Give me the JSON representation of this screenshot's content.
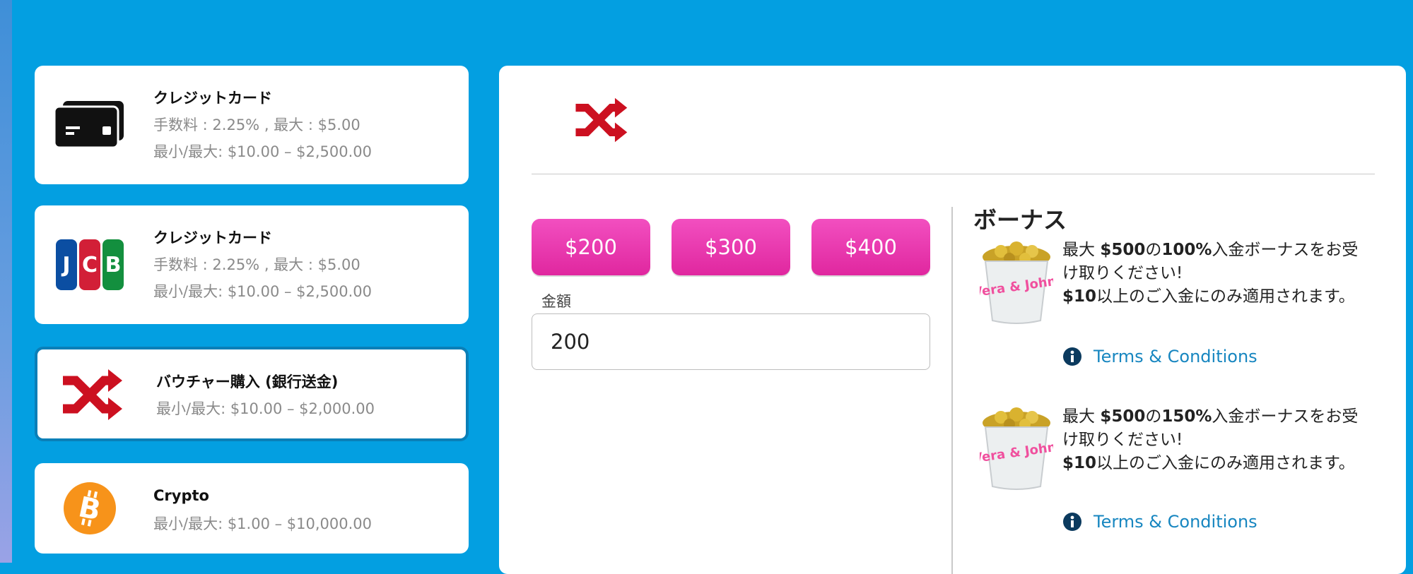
{
  "payment_methods": [
    {
      "icon": "credit-card-icon",
      "title": "クレジットカード",
      "fee": "手数料 : 2.25% , 最大 : $5.00",
      "limits": "最小/最大: $10.00 – $2,500.00",
      "selected": false
    },
    {
      "icon": "jcb-logo-icon",
      "title": "クレジットカード",
      "fee": "手数料 : 2.25% , 最大 : $5.00",
      "limits": "最小/最大: $10.00 – $2,500.00",
      "selected": false
    },
    {
      "icon": "shuffle-icon",
      "title": "バウチャー購入 (銀行送金)",
      "limits": "最小/最大: $10.00 – $2,000.00",
      "selected": true
    },
    {
      "icon": "bitcoin-icon",
      "title": "Crypto",
      "limits": "最小/最大: $1.00 – $10,000.00",
      "selected": false
    }
  ],
  "deposit": {
    "header_icon": "shuffle-icon",
    "quick_amounts": [
      "$200",
      "$300",
      "$400"
    ],
    "amount_label": "金額",
    "amount_value": "200"
  },
  "bonus": {
    "heading": "ボーナス",
    "offers": [
      {
        "image": "vera-john-coin-bucket",
        "image_text": "Vera & John",
        "prefix": "最大 ",
        "amount": "$500",
        "mid": "の",
        "percent": "100%",
        "suffix": "入金ボーナスをお受け取りください!",
        "min_amount": "$10",
        "min_text": "以上のご入金にのみ適用されます。",
        "terms_icon": "info-icon",
        "terms_label": "Terms & Conditions"
      },
      {
        "image": "vera-john-coin-bucket",
        "image_text": "Vera & John",
        "prefix": "最大 ",
        "amount": "$500",
        "mid": "の",
        "percent": "150%",
        "suffix": "入金ボーナスをお受け取りください!",
        "min_amount": "$10",
        "min_text": "以上のご入金にのみ適用されます。",
        "terms_icon": "info-icon",
        "terms_label": "Terms & Conditions"
      }
    ]
  },
  "colors": {
    "background": "#039fe1",
    "accent_pink": "#e8309f",
    "link_blue": "#1786c0",
    "shuffle_red": "#cc1020",
    "bitcoin_orange": "#f7931a"
  }
}
